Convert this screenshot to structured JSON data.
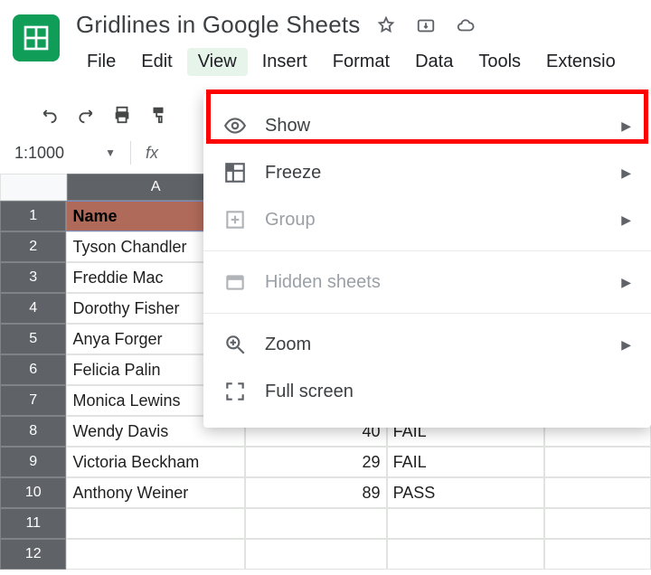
{
  "doc": {
    "title": "Gridlines in Google Sheets"
  },
  "menubar": {
    "file": "File",
    "edit": "Edit",
    "view": "View",
    "insert": "Insert",
    "format": "Format",
    "data": "Data",
    "tools": "Tools",
    "extensions": "Extensio"
  },
  "namebox": {
    "value": "1:1000"
  },
  "fx_label": "fx",
  "columns": {
    "a": "A"
  },
  "table": {
    "header": {
      "a": "Name"
    },
    "rows": [
      {
        "n": "1",
        "a": "Name",
        "b": "",
        "c": ""
      },
      {
        "n": "2",
        "a": "Tyson Chandler",
        "b": "",
        "c": ""
      },
      {
        "n": "3",
        "a": "Freddie Mac",
        "b": "",
        "c": ""
      },
      {
        "n": "4",
        "a": "Dorothy Fisher",
        "b": "",
        "c": ""
      },
      {
        "n": "5",
        "a": "Anya Forger",
        "b": "",
        "c": ""
      },
      {
        "n": "6",
        "a": "Felicia Palin",
        "b": "",
        "c": ""
      },
      {
        "n": "7",
        "a": "Monica Lewins",
        "b": "",
        "c": ""
      },
      {
        "n": "8",
        "a": "Wendy Davis",
        "b": "40",
        "c": "FAIL"
      },
      {
        "n": "9",
        "a": "Victoria Beckham",
        "b": "29",
        "c": "FAIL"
      },
      {
        "n": "10",
        "a": "Anthony Weiner",
        "b": "89",
        "c": "PASS"
      },
      {
        "n": "11",
        "a": "",
        "b": "",
        "c": ""
      },
      {
        "n": "12",
        "a": "",
        "b": "",
        "c": ""
      }
    ]
  },
  "view_menu": {
    "show": "Show",
    "freeze": "Freeze",
    "group": "Group",
    "hidden_sheets": "Hidden sheets",
    "zoom": "Zoom",
    "full_screen": "Full screen"
  }
}
